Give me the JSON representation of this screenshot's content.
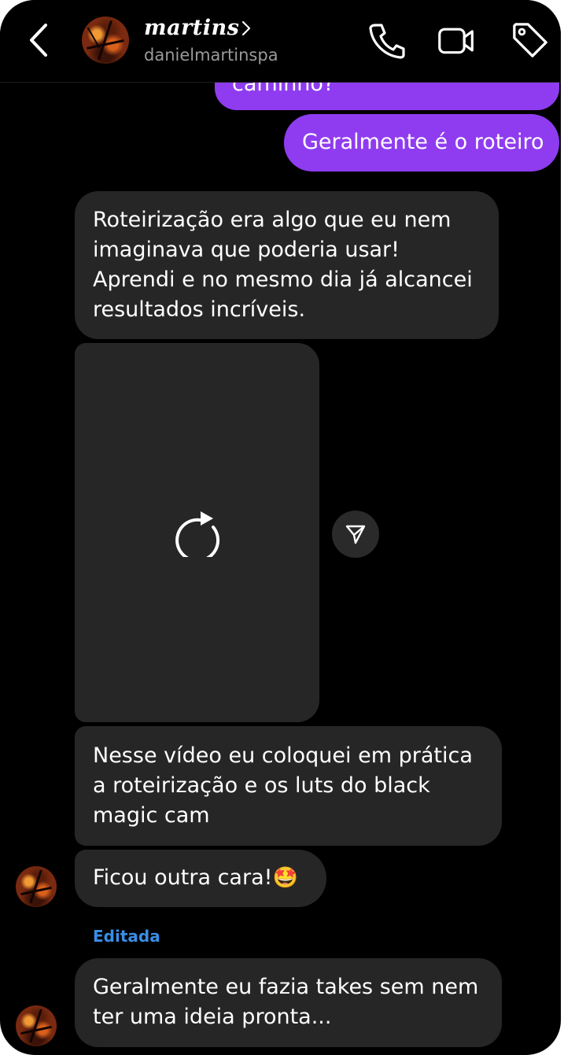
{
  "header": {
    "name": "martins",
    "username": "danielmartinspa"
  },
  "messages": {
    "sent_partial": "caminho?",
    "sent_1": "Geralmente é o roteiro",
    "recv_1_lines": [
      "Roteirização era algo que eu nem",
      "imaginava que poderia usar!",
      "Aprendi e no mesmo dia já alcancei",
      "resultados incríveis."
    ],
    "recv_2_lines": [
      "Nesse vídeo eu coloquei em prática",
      "a roteirização e os luts do black",
      "magic cam"
    ],
    "recv_3": "Ficou outra cara!",
    "recv_3_emoji": "🤩",
    "edited_label": "Editada",
    "recv_4_lines": [
      "Geralmente eu fazia takes sem nem",
      "ter uma ideia pronta..."
    ]
  },
  "icons": [
    "back-arrow-icon",
    "chevron-right-icon",
    "phone-icon",
    "video-camera-icon",
    "tag-icon",
    "reload-icon",
    "share-icon"
  ]
}
